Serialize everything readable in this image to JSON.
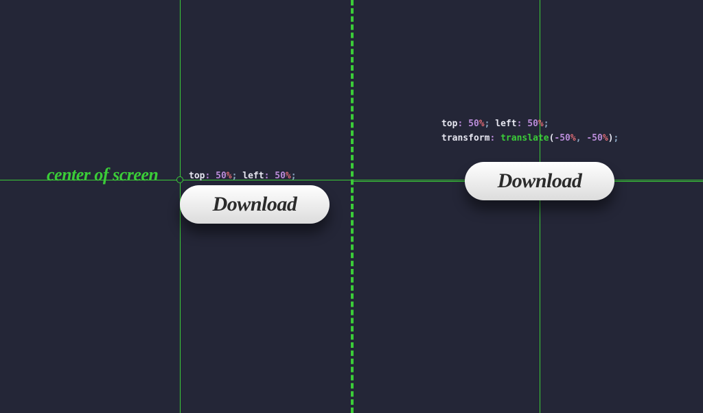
{
  "center_label": "center of screen",
  "left": {
    "code": {
      "prop1": "top",
      "val1_num": "50",
      "val1_unit": "%",
      "prop2": "left",
      "val2_num": "50",
      "val2_unit": "%"
    },
    "button_label": "Download"
  },
  "right": {
    "code_line1": {
      "prop1": "top",
      "val1_num": "50",
      "val1_unit": "%",
      "prop2": "left",
      "val2_num": "50",
      "val2_unit": "%"
    },
    "code_line2": {
      "prop": "transform",
      "func": "translate",
      "arg1_num": "-50",
      "arg1_unit": "%",
      "arg2_num": "-50",
      "arg2_unit": "%"
    },
    "button_label": "Download"
  },
  "colors": {
    "bg": "#242637",
    "accent": "#3bcc38"
  }
}
